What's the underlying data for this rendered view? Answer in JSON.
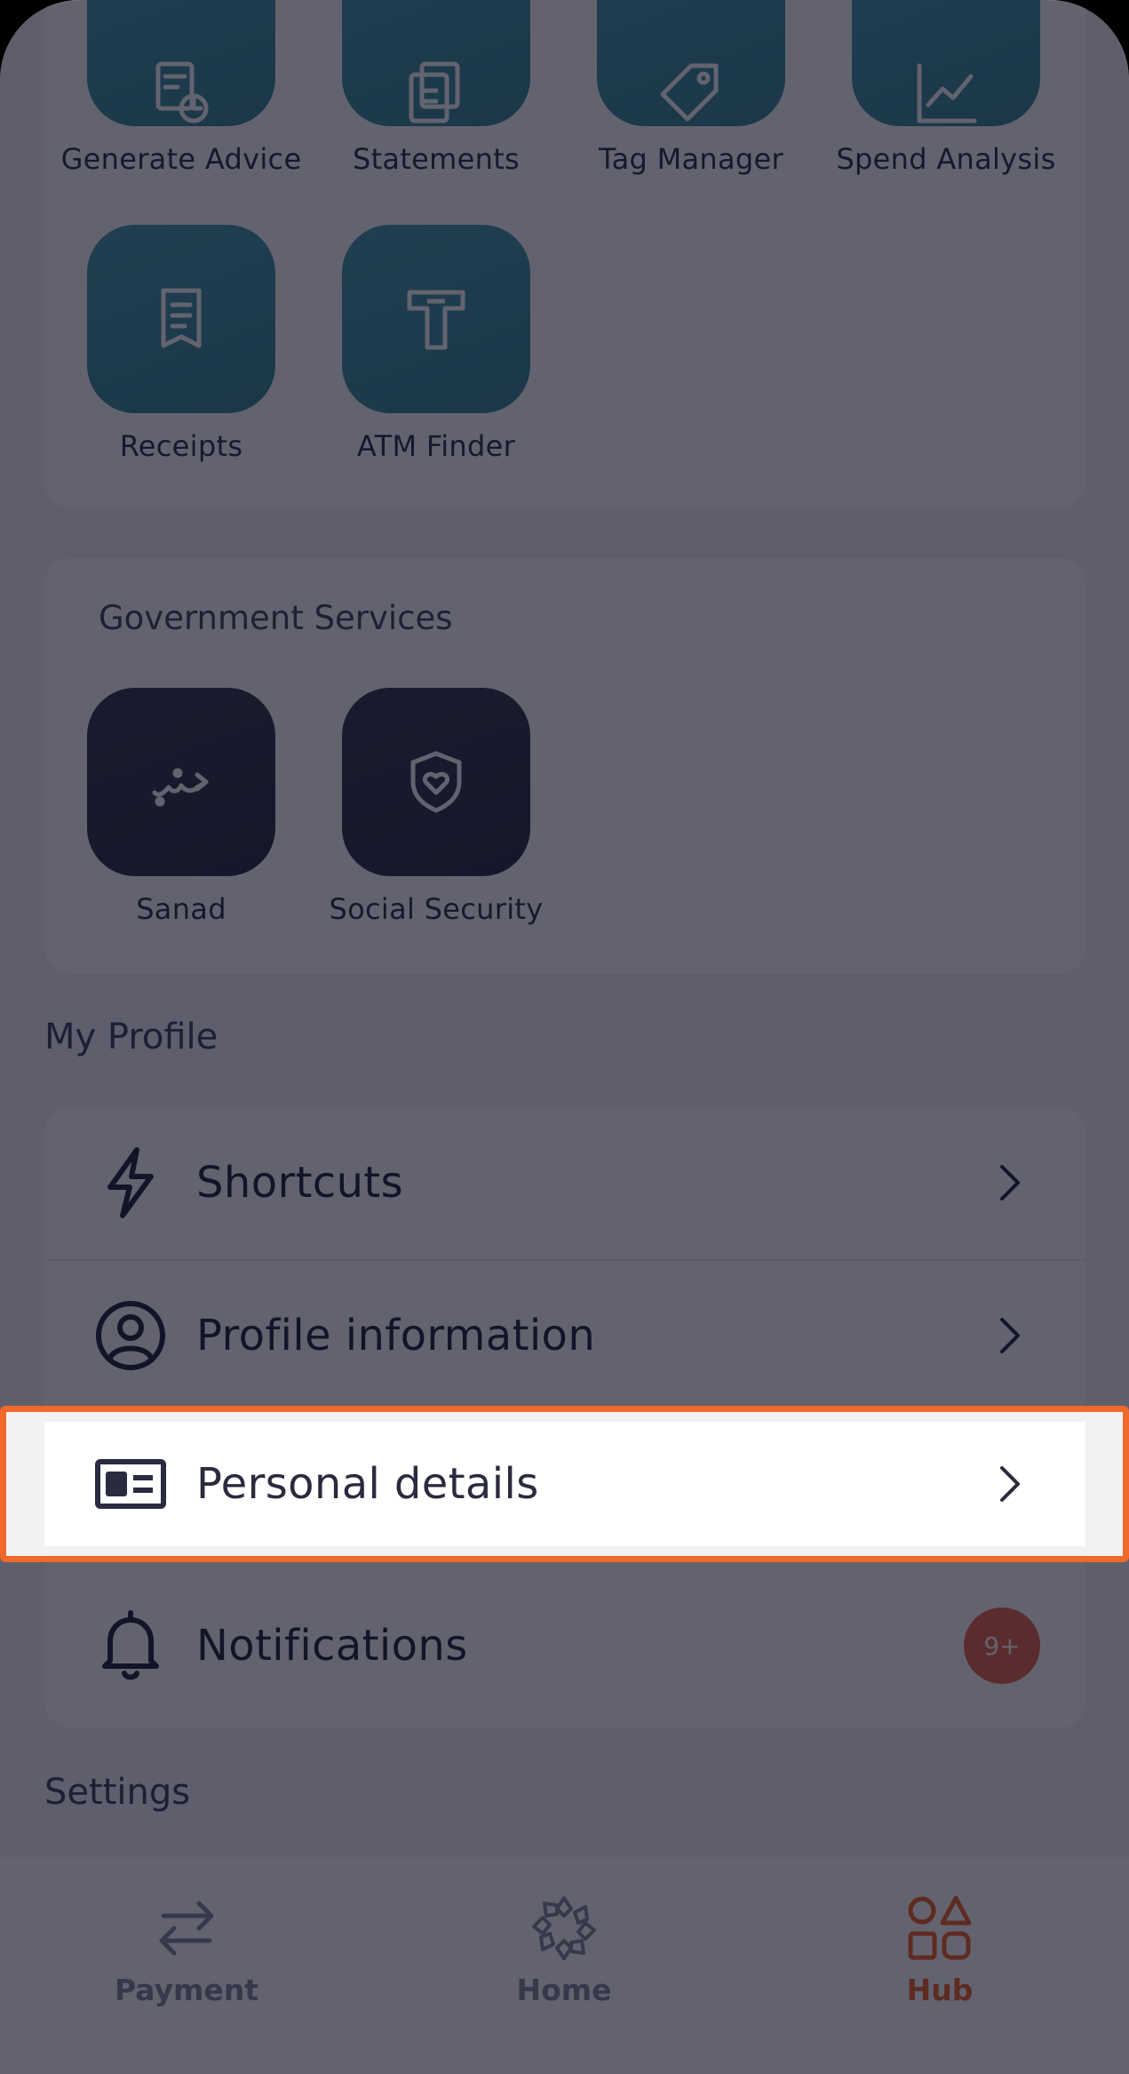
{
  "banking_tools": {
    "items": [
      {
        "label": "Generate Advice",
        "icon": "generate-advice-icon"
      },
      {
        "label": "Statements",
        "icon": "statements-icon"
      },
      {
        "label": "Tag Manager",
        "icon": "tag-icon"
      },
      {
        "label": "Spend Analysis",
        "icon": "chart-icon"
      },
      {
        "label": "Receipts",
        "icon": "receipt-icon"
      },
      {
        "label": "ATM Finder",
        "icon": "atm-icon"
      }
    ]
  },
  "government_services": {
    "title": "Government Services",
    "items": [
      {
        "label": "Sanad",
        "icon": "sanad-logo-icon"
      },
      {
        "label": "Social Security",
        "icon": "shield-heart-icon"
      }
    ]
  },
  "my_profile": {
    "title": "My Profile",
    "items": [
      {
        "label": "Shortcuts",
        "icon": "lightning-icon"
      },
      {
        "label": "Profile information",
        "icon": "user-circle-icon"
      },
      {
        "label": "Personal details",
        "icon": "id-card-icon"
      },
      {
        "label": "Notifications",
        "icon": "bell-icon",
        "badge": "9+"
      }
    ]
  },
  "settings": {
    "title": "Settings"
  },
  "bottom_nav": {
    "items": [
      {
        "label": "Payment",
        "icon": "transfer-arrows-icon"
      },
      {
        "label": "Home",
        "icon": "home-flower-icon"
      },
      {
        "label": "Hub",
        "icon": "shapes-icon",
        "active": true
      }
    ]
  },
  "colors": {
    "accent": "#f0692a",
    "teal_tile": "#3f8f99",
    "dark_tile": "#363648",
    "overlay": "#08081c",
    "badge": "#ea6a4a"
  }
}
